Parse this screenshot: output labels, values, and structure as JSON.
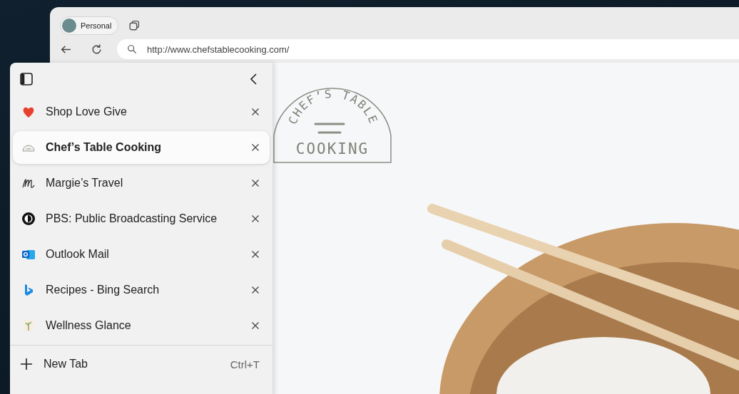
{
  "profile": {
    "label": "Personal"
  },
  "address_bar": {
    "url": "http://www.chefstablecooking.com/"
  },
  "tabs": [
    {
      "title": "Shop Love Give",
      "kind": "heart",
      "selected": false
    },
    {
      "title": "Chef’s Table Cooking",
      "kind": "badge",
      "selected": true
    },
    {
      "title": "Margie’s Travel",
      "kind": "script",
      "selected": false
    },
    {
      "title": "PBS: Public Broadcasting Service",
      "kind": "pbs",
      "selected": false
    },
    {
      "title": "Outlook Mail",
      "kind": "outlook",
      "selected": false
    },
    {
      "title": "Recipes - Bing Search",
      "kind": "bing",
      "selected": false
    },
    {
      "title": "Wellness Glance",
      "kind": "plant",
      "selected": false
    }
  ],
  "new_tab": {
    "label": "New Tab",
    "shortcut": "Ctrl+T"
  },
  "page": {
    "logo_arc": "CHEF’S TABLE",
    "logo_word": "COOKING"
  }
}
